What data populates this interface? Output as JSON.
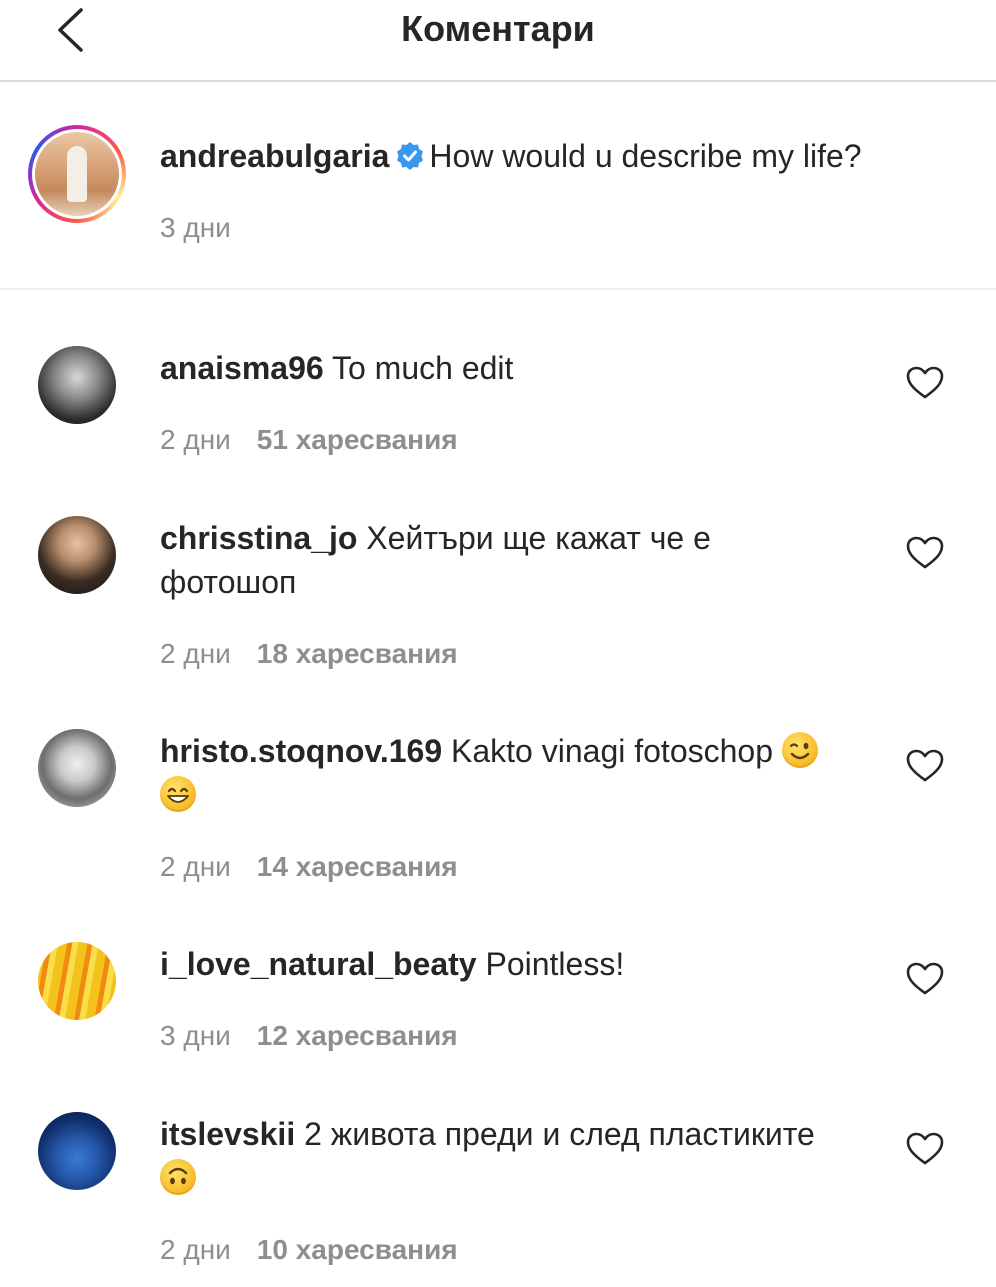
{
  "header": {
    "title": "Коментари"
  },
  "post": {
    "username": "andreabulgaria",
    "caption": "How would u describe my life?",
    "time": "3 дни"
  },
  "comments": [
    {
      "username": "anaisma96",
      "text": "To much edit",
      "time": "2 дни",
      "likes": "51 харесвания"
    },
    {
      "username": "chrisstina_jo",
      "text": "Хейтъри ще кажат че е фотошоп",
      "time": "2 дни",
      "likes": "18 харесвания"
    },
    {
      "username": "hristo.stoqnov.169",
      "text": "Kakto vinagi fotoschop",
      "emojis": [
        "winking-face-emoji",
        "grinning-face-emoji"
      ],
      "time": "2 дни",
      "likes": "14 харесвания"
    },
    {
      "username": "i_love_natural_beaty",
      "text": "Pointless!",
      "time": "3 дни",
      "likes": "12 харесвания"
    },
    {
      "username": "itslevskii",
      "text": "2 живота преди и след пластиките",
      "emojis": [
        "upside-down-face-emoji"
      ],
      "time": "2 дни",
      "likes": "10 харесвания"
    }
  ],
  "icons": {
    "back": "chevron-left-icon",
    "verified": "verified-badge-icon",
    "like": "heart-outline-icon"
  },
  "colors": {
    "text": "#262626",
    "secondary": "#8e8e8e",
    "verified": "#3897f0",
    "divider": "#dbdbdb"
  }
}
